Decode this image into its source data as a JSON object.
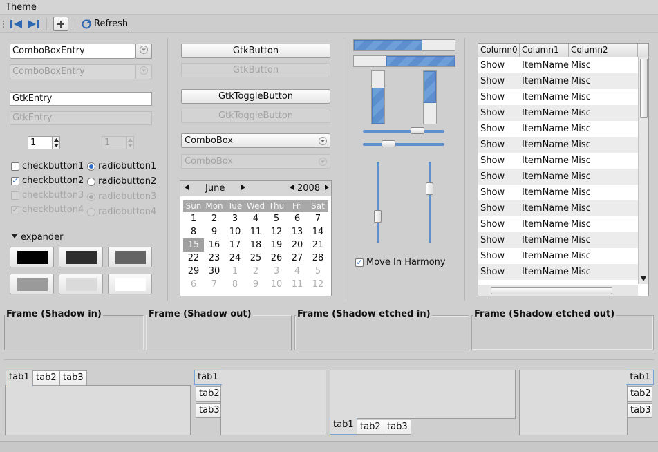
{
  "menubar": {
    "theme": "Theme"
  },
  "toolbar": {
    "refresh": "Refresh"
  },
  "combo_entry": {
    "value": "ComboBoxEntry",
    "disabled_value": "ComboBoxEntry"
  },
  "entry": {
    "value": "GtkEntry",
    "disabled_value": "GtkEntry"
  },
  "spin": {
    "value": "1",
    "disabled_value": "1"
  },
  "checks": {
    "c1": "checkbutton1",
    "c2": "checkbutton2",
    "c3": "checkbutton3",
    "c4": "checkbutton4"
  },
  "radios": {
    "r1": "radiobutton1",
    "r2": "radiobutton2",
    "r3": "radiobutton3",
    "r4": "radiobutton4"
  },
  "expander": {
    "label": "expander"
  },
  "buttons": {
    "gtk": "GtkButton",
    "gtk_dis": "GtkButton",
    "toggle": "GtkToggleButton",
    "toggle_dis": "GtkToggleButton"
  },
  "combobox": {
    "value": "ComboBox",
    "disabled_value": "ComboBox"
  },
  "calendar": {
    "month": "June",
    "year": "2008",
    "days": [
      "Sun",
      "Mon",
      "Tue",
      "Wed",
      "Thu",
      "Fri",
      "Sat"
    ],
    "cells": [
      "1",
      "2",
      "3",
      "4",
      "5",
      "6",
      "7",
      "8",
      "9",
      "10",
      "11",
      "12",
      "13",
      "14",
      "15",
      "16",
      "17",
      "18",
      "19",
      "20",
      "21",
      "22",
      "23",
      "24",
      "25",
      "26",
      "27",
      "28",
      "29",
      "30",
      "1",
      "2",
      "3",
      "4",
      "5",
      "6",
      "7",
      "8",
      "9",
      "10",
      "11",
      "12"
    ],
    "selected": "15"
  },
  "progress": {
    "h1": 0.68,
    "h2": 0.68,
    "v1": 0.68,
    "v2": 0.6
  },
  "scales": {
    "h1": 0.7,
    "h2": 0.28,
    "v1": 0.7,
    "v2": 0.3
  },
  "harmony": {
    "label": "Move In Harmony"
  },
  "tree": {
    "columns": [
      "Column0",
      "Column1",
      "Column2"
    ],
    "rows": [
      [
        "Show",
        "ItemName",
        "Misc"
      ],
      [
        "Show",
        "ItemName",
        "Misc"
      ],
      [
        "Show",
        "ItemName",
        "Misc"
      ],
      [
        "Show",
        "ItemName",
        "Misc"
      ],
      [
        "Show",
        "ItemName",
        "Misc"
      ],
      [
        "Show",
        "ItemName",
        "Misc"
      ],
      [
        "Show",
        "ItemName",
        "Misc"
      ],
      [
        "Show",
        "ItemName",
        "Misc"
      ],
      [
        "Show",
        "ItemName",
        "Misc"
      ],
      [
        "Show",
        "ItemName",
        "Misc"
      ],
      [
        "Show",
        "ItemName",
        "Misc"
      ],
      [
        "Show",
        "ItemName",
        "Misc"
      ],
      [
        "Show",
        "ItemName",
        "Misc"
      ],
      [
        "Show",
        "ItemName",
        "Misc"
      ]
    ]
  },
  "frames": {
    "in": "Frame (Shadow in)",
    "out": "Frame (Shadow out)",
    "etched_in": "Frame (Shadow etched in)",
    "etched_out": "Frame (Shadow etched out)"
  },
  "tabs": {
    "t1": "tab1",
    "t2": "tab2",
    "t3": "tab3"
  },
  "colors": {
    "accent": "#5f8fcc",
    "background": "#cfcfcf"
  },
  "icons": [
    "back-icon",
    "forward-icon",
    "add-icon",
    "refresh-icon",
    "chevron-down-icon",
    "spin-arrows-icon",
    "expander-arrow-icon"
  ]
}
